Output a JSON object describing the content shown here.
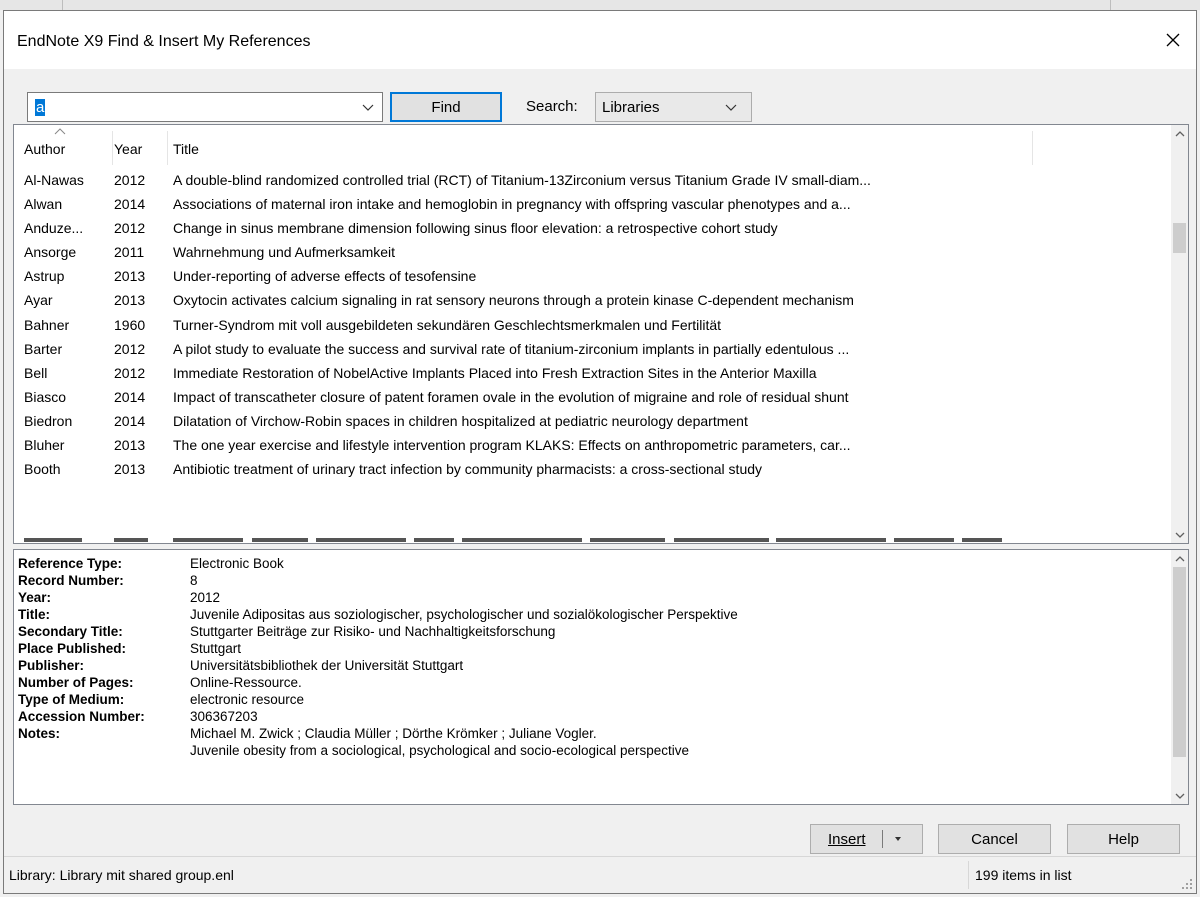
{
  "window": {
    "title": "EndNote X9 Find & Insert My References"
  },
  "search": {
    "query": "a",
    "find_label": "Find",
    "search_label": "Search:",
    "search_in": "Libraries"
  },
  "list": {
    "headers": {
      "author": "Author",
      "year": "Year",
      "title": "Title"
    },
    "rows": [
      {
        "author": "Al-Nawas",
        "year": "2012",
        "title": "A double-blind randomized controlled trial (RCT) of Titanium-13Zirconium versus Titanium Grade IV small-diam..."
      },
      {
        "author": "Alwan",
        "year": "2014",
        "title": "Associations of maternal iron intake and hemoglobin in pregnancy with offspring vascular phenotypes and a..."
      },
      {
        "author": "Anduze...",
        "year": "2012",
        "title": "Change in sinus membrane dimension following sinus floor elevation: a retrospective cohort study"
      },
      {
        "author": "Ansorge",
        "year": "2011",
        "title": "Wahrnehmung und Aufmerksamkeit"
      },
      {
        "author": "Astrup",
        "year": "2013",
        "title": "Under-reporting of adverse effects of tesofensine"
      },
      {
        "author": "Ayar",
        "year": "2013",
        "title": "Oxytocin activates calcium signaling in rat sensory neurons through a protein kinase C-dependent mechanism"
      },
      {
        "author": "Bahner",
        "year": "1960",
        "title": "Turner-Syndrom mit voll ausgebildeten sekundären Geschlechtsmerkmalen und Fertilität"
      },
      {
        "author": "Barter",
        "year": "2012",
        "title": "A pilot study to evaluate the success and survival rate of titanium-zirconium implants in partially edentulous ..."
      },
      {
        "author": "Bell",
        "year": "2012",
        "title": "Immediate Restoration of NobelActive Implants Placed into Fresh Extraction Sites in the Anterior Maxilla"
      },
      {
        "author": "Biasco",
        "year": "2014",
        "title": "Impact of transcatheter closure of patent foramen ovale in the evolution of migraine and role of residual shunt"
      },
      {
        "author": "Biedron",
        "year": "2014",
        "title": "Dilatation of Virchow-Robin spaces in children hospitalized at pediatric neurology department"
      },
      {
        "author": "Bluher",
        "year": "2013",
        "title": "The one year exercise and lifestyle intervention program KLAKS: Effects on anthropometric parameters, car..."
      },
      {
        "author": "Booth",
        "year": "2013",
        "title": "Antibiotic treatment of urinary tract infection by community pharmacists: a cross-sectional study"
      }
    ]
  },
  "details": {
    "fields": [
      {
        "label": "Reference Type:",
        "value": "Electronic Book"
      },
      {
        "label": "Record Number:",
        "value": "8"
      },
      {
        "label": "Year:",
        "value": "2012"
      },
      {
        "label": "Title:",
        "value": "Juvenile Adipositas aus soziologischer, psychologischer und sozialökologischer Perspektive"
      },
      {
        "label": "Secondary Title:",
        "value": "Stuttgarter Beiträge zur Risiko- und Nachhaltigkeitsforschung"
      },
      {
        "label": "Place Published:",
        "value": "Stuttgart"
      },
      {
        "label": "Publisher:",
        "value": "Universitätsbibliothek der Universität Stuttgart"
      },
      {
        "label": "Number of Pages:",
        "value": "Online-Ressource."
      },
      {
        "label": "Type of Medium:",
        "value": "electronic resource"
      },
      {
        "label": "Accession Number:",
        "value": "306367203"
      },
      {
        "label": "Notes:",
        "value": "Michael M. Zwick ; Claudia Müller ; Dörthe Krömker ; Juliane Vogler."
      }
    ],
    "notes_line2": "Juvenile obesity from a sociological, psychological and socio-ecological perspective"
  },
  "buttons": {
    "insert": "Insert",
    "cancel": "Cancel",
    "help": "Help"
  },
  "status": {
    "library": "Library: Library mit shared group.enl",
    "count": "199 items in list"
  }
}
